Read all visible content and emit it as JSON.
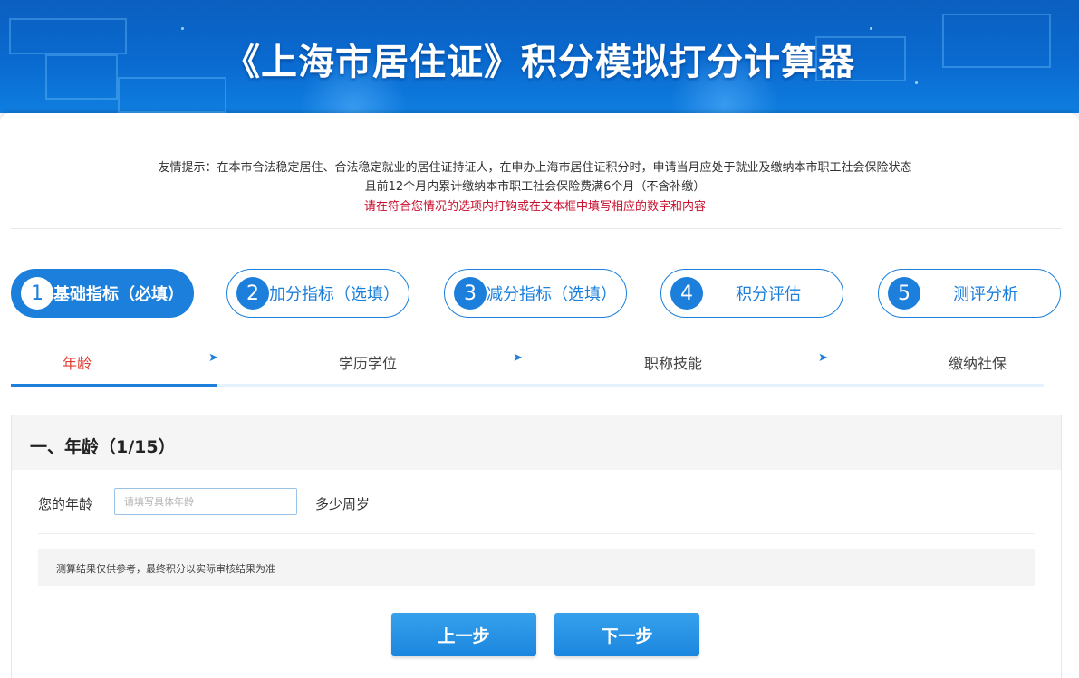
{
  "banner": {
    "title": "《上海市居住证》积分模拟打分计算器"
  },
  "tips": {
    "line1": "友情提示：在本市合法稳定居住、合法稳定就业的居住证持证人，在申办上海市居住证积分时，申请当月应处于就业及缴纳本市职工社会保险状态",
    "line2": "且前12个月内累计缴纳本市职工社会保险费满6个月（不含补缴）",
    "line3": "请在符合您情况的选项内打钩或在文本框中填写相应的数字和内容"
  },
  "steps": [
    {
      "num": "1",
      "label": "基础指标（必填）",
      "active": true
    },
    {
      "num": "2",
      "label": "加分指标（选填）",
      "active": false
    },
    {
      "num": "3",
      "label": "减分指标（选填）",
      "active": false
    },
    {
      "num": "4",
      "label": "积分评估",
      "active": false
    },
    {
      "num": "5",
      "label": "测评分析",
      "active": false
    }
  ],
  "substeps": [
    {
      "label": "年龄",
      "active": true
    },
    {
      "label": "学历学位",
      "active": false
    },
    {
      "label": "职称技能",
      "active": false
    },
    {
      "label": "缴纳社保",
      "active": false
    }
  ],
  "arrow_glyph": "➤",
  "progress": {
    "fraction": 0.2
  },
  "section": {
    "title": "一、年龄（1/15）",
    "field_label": "您的年龄",
    "field_value": "",
    "field_placeholder": "请填写具体年龄",
    "field_unit": "多少周岁",
    "note": "测算结果仅供参考，最终积分以实际审核结果为准"
  },
  "buttons": {
    "prev": "上一步",
    "next": "下一步"
  },
  "colors": {
    "primary": "#1b7fdb",
    "active_substep": "#e03b30",
    "warning_text": "#c8102e"
  }
}
